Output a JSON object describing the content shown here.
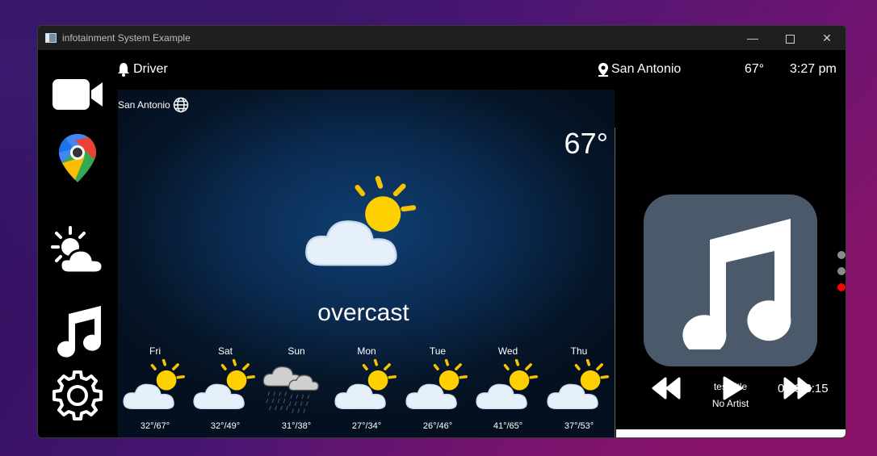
{
  "window": {
    "title": "infotainment System Example"
  },
  "titlebar": {
    "minimize": "—",
    "close": "✕"
  },
  "sidebar": {
    "items": [
      "video-camera-icon",
      "google-maps-icon",
      "weather-icon",
      "music-note-icon",
      "gear-icon"
    ]
  },
  "topbar": {
    "driver": "Driver",
    "city": "San Antonio",
    "temp": "67°",
    "time": "3:27 pm"
  },
  "weather": {
    "location": "San Antonio",
    "temperature": "67°",
    "condition": "overcast",
    "forecast": [
      {
        "day": "Fri",
        "range": "32°/67°",
        "icon": "partly-cloudy"
      },
      {
        "day": "Sat",
        "range": "32°/49°",
        "icon": "partly-cloudy"
      },
      {
        "day": "Sun",
        "range": "31°/38°",
        "icon": "rain"
      },
      {
        "day": "Mon",
        "range": "27°/34°",
        "icon": "partly-cloudy"
      },
      {
        "day": "Tue",
        "range": "26°/46°",
        "icon": "partly-cloudy"
      },
      {
        "day": "Wed",
        "range": "41°/65°",
        "icon": "partly-cloudy"
      },
      {
        "day": "Thu",
        "range": "37°/53°",
        "icon": "partly-cloudy"
      }
    ]
  },
  "music": {
    "title": "test title",
    "artist": "No Artist",
    "time": "0:00/3:15",
    "progress": 0
  },
  "pager": {
    "count": 3,
    "active": 3,
    "colors": {
      "inactive": "#8a8a8a",
      "active": "#ff0000"
    }
  },
  "colors": {
    "art_bg": "#4a5a6a",
    "sun": "#ffcc00",
    "cloud": "#e6f0fb"
  }
}
